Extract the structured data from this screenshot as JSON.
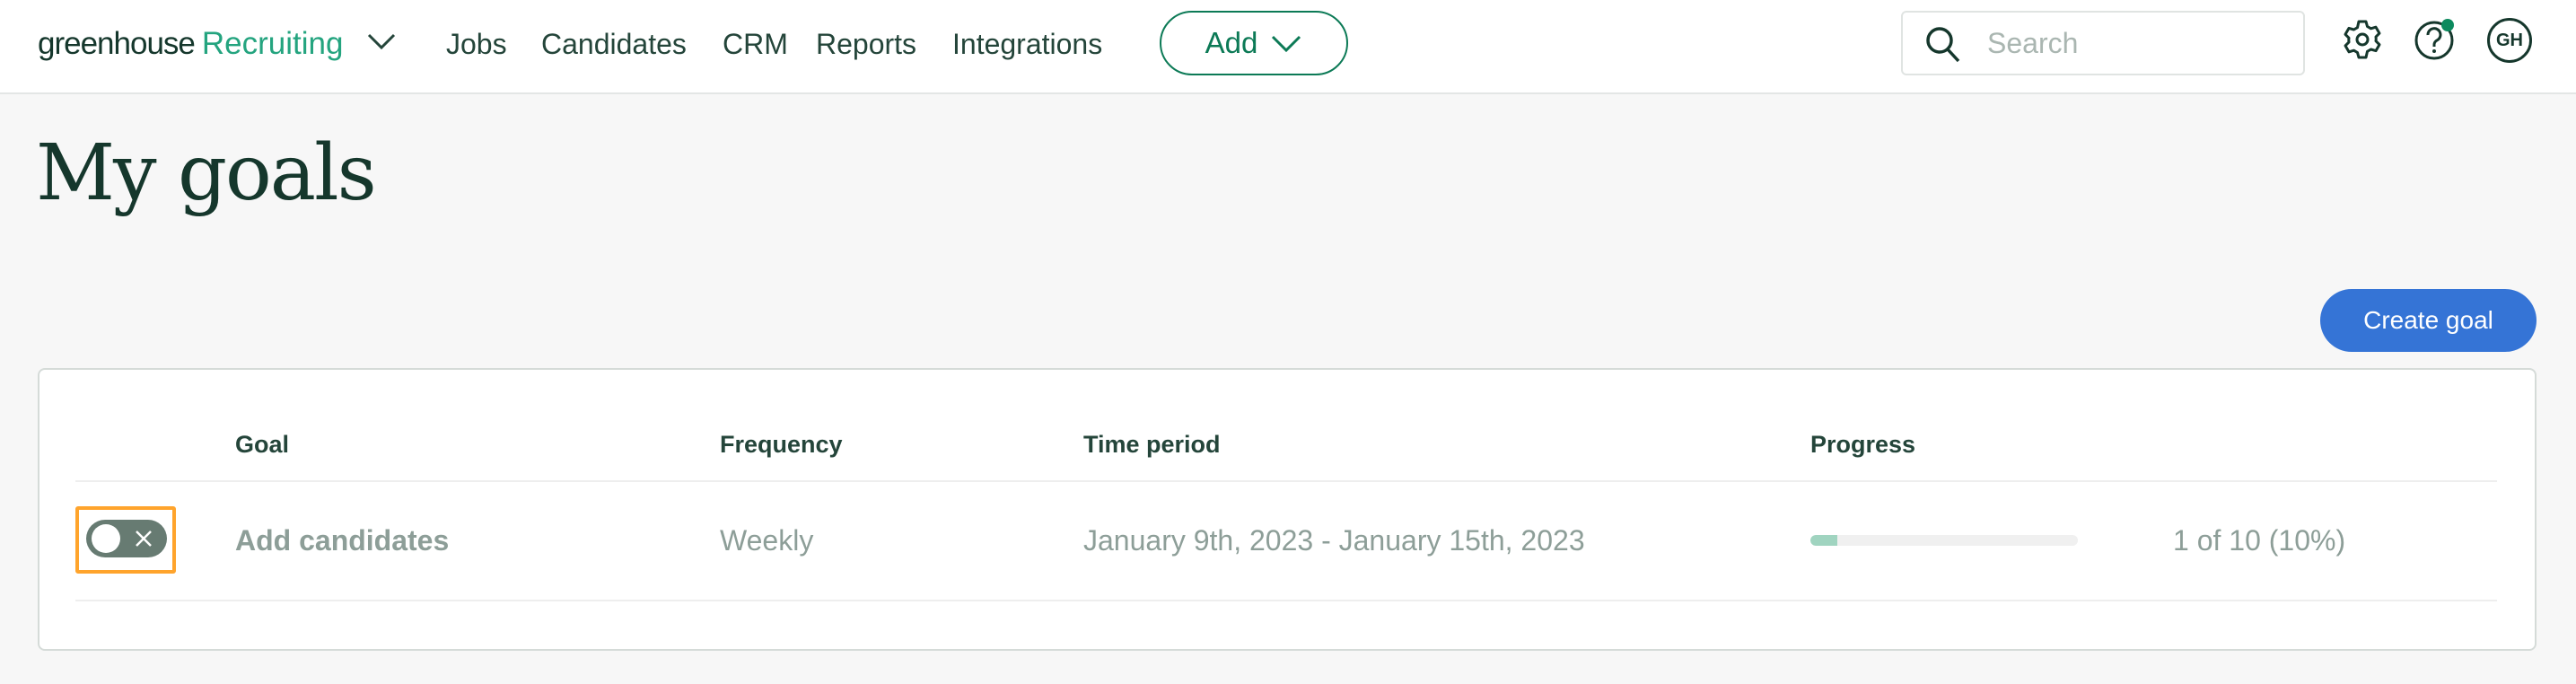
{
  "header": {
    "logo_brand": "greenhouse",
    "logo_product": "Recruiting",
    "nav": [
      "Jobs",
      "Candidates",
      "CRM",
      "Reports",
      "Integrations"
    ],
    "add_label": "Add",
    "search_placeholder": "Search",
    "search_value": "",
    "avatar_initials": "GH",
    "icons": [
      "chevron-down-icon",
      "search-icon",
      "gear-icon",
      "help-icon",
      "notification-dot"
    ]
  },
  "page": {
    "title": "My goals",
    "create_button": "Create goal"
  },
  "table": {
    "columns": [
      "Goal",
      "Frequency",
      "Time period",
      "Progress"
    ],
    "rows": [
      {
        "enabled": false,
        "goal": "Add candidates",
        "frequency": "Weekly",
        "time_period": "January 9th, 2023 - January 15th, 2023",
        "progress_text": "1 of 10 (10%)",
        "progress_fraction": 0.1
      }
    ]
  },
  "colors": {
    "brand_green": "#24a47f",
    "dark_green": "#15372c",
    "primary_blue": "#3574d6",
    "highlight_orange": "#ffa42c",
    "progress_fill": "#a0d4c0",
    "notification_green": "#0c8a5e"
  }
}
